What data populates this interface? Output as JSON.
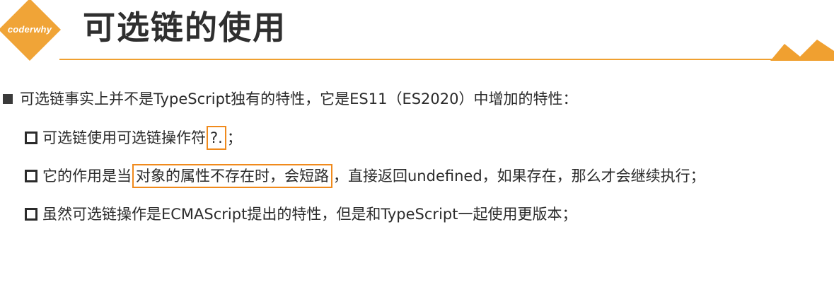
{
  "logo": {
    "text": "coderwhy"
  },
  "header": {
    "title": "可选链的使用"
  },
  "colors": {
    "accent": "#f08a1c",
    "logo": "#f0a437",
    "rule": "#f0a030"
  },
  "content": {
    "line1": "可选链事实上并不是TypeScript独有的特性，它是ES11（ES2020）中增加的特性：",
    "line2": {
      "before": "可选链使用可选链操作符",
      "highlight": "?.",
      "after": "；"
    },
    "line3": {
      "before": "它的作用是当",
      "highlight": "对象的属性不存在时，会短路",
      "after": "，直接返回undefined，如果存在，那么才会继续执行；"
    },
    "line4": "虽然可选链操作是ECMAScript提出的特性，但是和TypeScript一起使用更版本；"
  }
}
